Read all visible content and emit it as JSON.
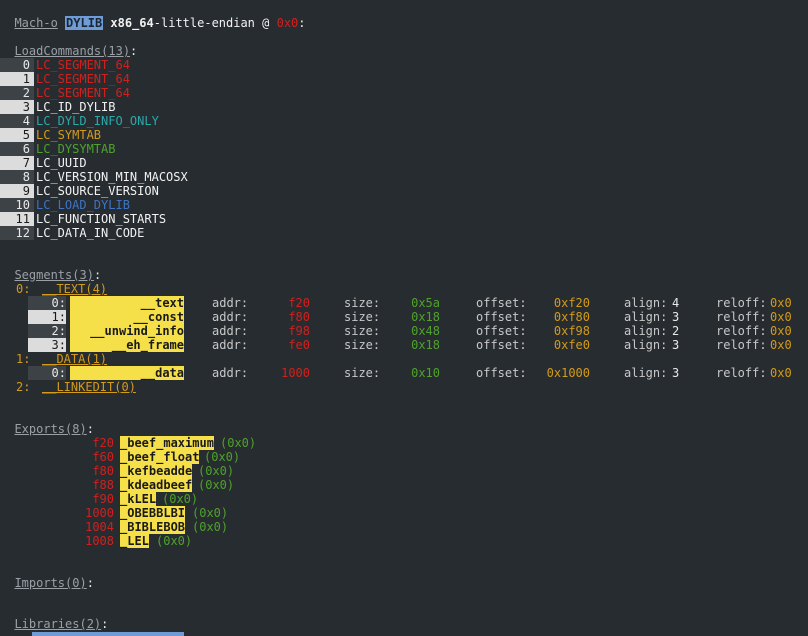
{
  "header": {
    "format": "Mach-o",
    "filetype": "DYLIB",
    "arch": "x86_64",
    "rest": "-little-endian @ ",
    "addr": "0x0",
    "colon": ":"
  },
  "load_commands": {
    "title": "LoadCommands(13)",
    "colon": ":",
    "items": [
      {
        "index": "0",
        "name": "LC_SEGMENT_64"
      },
      {
        "index": "1",
        "name": "LC_SEGMENT_64"
      },
      {
        "index": "2",
        "name": "LC_SEGMENT_64"
      },
      {
        "index": "3",
        "name": "LC_ID_DYLIB"
      },
      {
        "index": "4",
        "name": "LC_DYLD_INFO_ONLY"
      },
      {
        "index": "5",
        "name": "LC_SYMTAB"
      },
      {
        "index": "6",
        "name": "LC_DYSYMTAB"
      },
      {
        "index": "7",
        "name": "LC_UUID"
      },
      {
        "index": "8",
        "name": "LC_VERSION_MIN_MACOSX"
      },
      {
        "index": "9",
        "name": "LC_SOURCE_VERSION"
      },
      {
        "index": "10",
        "name": "LC_LOAD_DYLIB"
      },
      {
        "index": "11",
        "name": "LC_FUNCTION_STARTS"
      },
      {
        "index": "12",
        "name": "LC_DATA_IN_CODE"
      }
    ]
  },
  "segments": {
    "title": "Segments(3)",
    "colon": ":",
    "seg0": {
      "index": "0:",
      "name": "__TEXT(4)"
    },
    "seg1": {
      "index": "1:",
      "name": "__DATA(1)"
    },
    "seg2": {
      "index": "2:",
      "name": "__LINKEDIT(0)"
    },
    "labels": {
      "addr": "addr:",
      "size": "size:",
      "offset": "offset:",
      "align": "align:",
      "reloff": "reloff:"
    },
    "sections": [
      {
        "index": "0:",
        "name": "__text",
        "addr": "f20",
        "size": "0x5a",
        "offset": "0xf20",
        "align": "4",
        "reloff": "0x0"
      },
      {
        "index": "1:",
        "name": "__const",
        "addr": "f80",
        "size": "0x18",
        "offset": "0xf80",
        "align": "3",
        "reloff": "0x0"
      },
      {
        "index": "2:",
        "name": "__unwind_info",
        "addr": "f98",
        "size": "0x48",
        "offset": "0xf98",
        "align": "2",
        "reloff": "0x0"
      },
      {
        "index": "3:",
        "name": "__eh_frame",
        "addr": "fe0",
        "size": "0x18",
        "offset": "0xfe0",
        "align": "3",
        "reloff": "0x0"
      },
      {
        "index": "0:",
        "name": "__data",
        "addr": "1000",
        "size": "0x10",
        "offset": "0x1000",
        "align": "3",
        "reloff": "0x0"
      }
    ]
  },
  "exports": {
    "title": "Exports(8)",
    "colon": ":",
    "items": [
      {
        "addr": "f20",
        "name": "_beef_maximum",
        "flags": "(0x0)"
      },
      {
        "addr": "f60",
        "name": "_beef_float",
        "flags": "(0x0)"
      },
      {
        "addr": "f80",
        "name": "_kefbeadde",
        "flags": "(0x0)"
      },
      {
        "addr": "f88",
        "name": "_kdeadbeef",
        "flags": "(0x0)"
      },
      {
        "addr": "f90",
        "name": "_kLEL",
        "flags": "(0x0)"
      },
      {
        "addr": "1000",
        "name": "_OBEBBLBI",
        "flags": "(0x0)"
      },
      {
        "addr": "1004",
        "name": "_BIBLEBOB",
        "flags": "(0x0)"
      },
      {
        "addr": "1008",
        "name": "_LEL",
        "flags": "(0x0)"
      }
    ]
  },
  "imports": {
    "title": "Imports(0)",
    "colon": ":"
  },
  "libraries": {
    "title": "Libraries(2)",
    "colon": ":"
  },
  "colors": {
    "background": "#272c31",
    "segment_red": "#d0211d",
    "dyld_teal": "#2aa9a9",
    "symtab_orange": "#d39b1a",
    "dysymtab_green": "#4fa22b",
    "load_dylib_blue": "#3d74c6",
    "highlight_yellow": "#f6e04a",
    "highlight_blue": "#6f9cd6"
  }
}
